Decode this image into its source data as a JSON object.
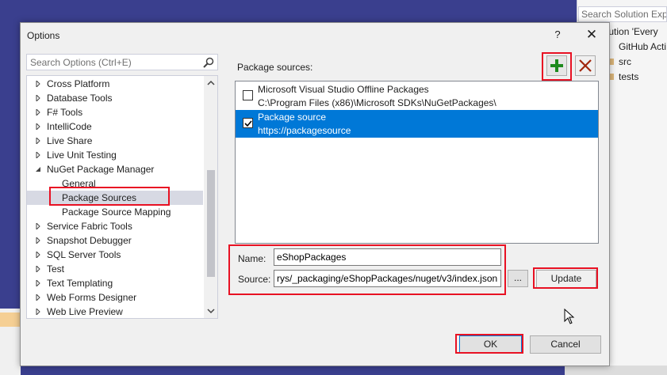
{
  "background": {
    "search_placeholder": "Search Solution Explo",
    "tree_items": [
      "olution 'Every",
      "GitHub Acti",
      "src",
      "tests"
    ]
  },
  "dialog": {
    "title": "Options",
    "help_label": "?",
    "close_label": "✕"
  },
  "search": {
    "placeholder": "Search Options (Ctrl+E)"
  },
  "tree": {
    "items": [
      {
        "label": "Cross Platform",
        "state": "collapsed"
      },
      {
        "label": "Database Tools",
        "state": "collapsed"
      },
      {
        "label": "F# Tools",
        "state": "collapsed"
      },
      {
        "label": "IntelliCode",
        "state": "collapsed"
      },
      {
        "label": "Live Share",
        "state": "collapsed"
      },
      {
        "label": "Live Unit Testing",
        "state": "collapsed"
      },
      {
        "label": "NuGet Package Manager",
        "state": "expanded"
      },
      {
        "label": "General",
        "state": "child"
      },
      {
        "label": "Package Sources",
        "state": "child-selected"
      },
      {
        "label": "Package Source Mapping",
        "state": "child"
      },
      {
        "label": "Service Fabric Tools",
        "state": "collapsed"
      },
      {
        "label": "Snapshot Debugger",
        "state": "collapsed"
      },
      {
        "label": "SQL Server Tools",
        "state": "collapsed"
      },
      {
        "label": "Test",
        "state": "collapsed"
      },
      {
        "label": "Text Templating",
        "state": "collapsed"
      },
      {
        "label": "Web Forms Designer",
        "state": "collapsed"
      },
      {
        "label": "Web Live Preview",
        "state": "collapsed"
      }
    ]
  },
  "sources": {
    "heading": "Package sources:",
    "items": [
      {
        "name": "Microsoft Visual Studio Offline Packages",
        "source": "C:\\Program Files (x86)\\Microsoft SDKs\\NuGetPackages\\",
        "checked": false,
        "selected": false
      },
      {
        "name": "Package source",
        "source": "https://packagesource",
        "checked": true,
        "selected": true
      }
    ]
  },
  "form": {
    "name_label": "Name:",
    "name_value": "eShopPackages",
    "source_label": "Source:",
    "source_value": "rys/_packaging/eShopPackages/nuget/v3/index.json",
    "browse_label": "...",
    "update_label": "Update"
  },
  "buttons": {
    "ok_label": "OK",
    "cancel_label": "Cancel"
  },
  "colors": {
    "selection_blue": "#0078d7",
    "highlight_red": "#e81123",
    "add_green": "#1e8a1e",
    "remove_red": "#a1260d"
  }
}
